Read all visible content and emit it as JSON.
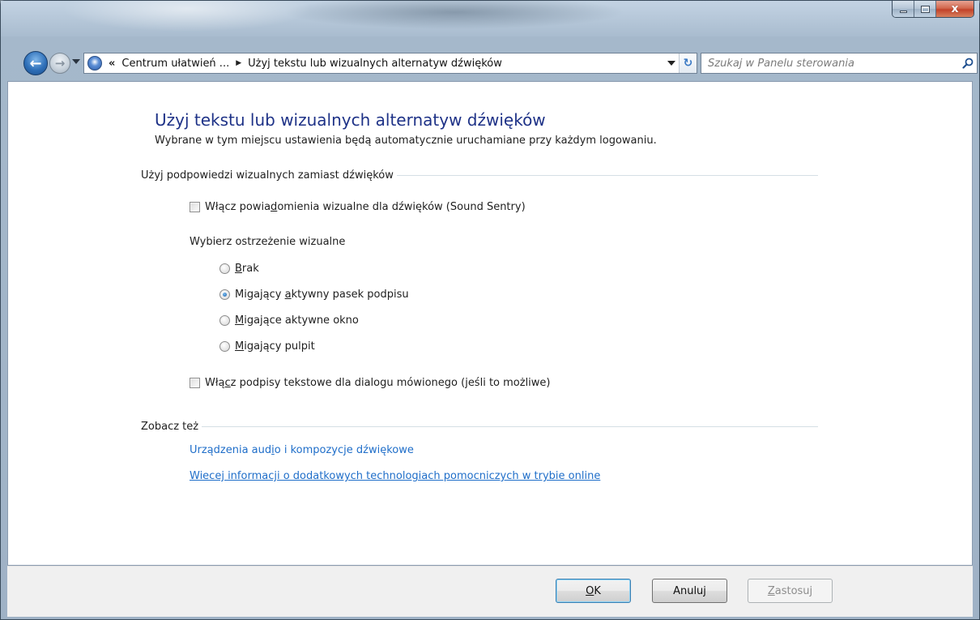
{
  "window": {
    "caption": {
      "min": "–",
      "max": "□",
      "close": "x"
    }
  },
  "nav": {
    "back_glyph": "←",
    "forward_glyph": "→",
    "address": {
      "chevrons": "«",
      "crumb1": "Centrum ułatwień ...",
      "separator": "▶",
      "crumb2": "Użyj tekstu lub wizualnych alternatyw dźwięków"
    },
    "refresh_glyph": "↻",
    "search_placeholder": "Szukaj w Panelu sterowania"
  },
  "page": {
    "title": "Użyj tekstu lub wizualnych alternatyw dźwięków",
    "subtitle": "Wybrane w tym miejscu ustawienia będą automatycznie uruchamiane przy każdym logowaniu."
  },
  "section_visual": {
    "heading": "Użyj podpowiedzi wizualnych zamiast dźwięków",
    "sound_sentry": {
      "label_pre": "Włącz powia",
      "label_ul": "d",
      "label_post": "omienia wizualne dla dźwięków (Sound Sentry)",
      "checked": false
    },
    "warning_label": "Wybierz ostrzeżenie wizualne",
    "options": [
      {
        "pre": "",
        "ul": "B",
        "post": "rak",
        "checked": false
      },
      {
        "pre": "Migający ",
        "ul": "a",
        "post": "ktywny pasek podpisu",
        "checked": true
      },
      {
        "pre": "",
        "ul": "M",
        "post": "igające aktywne okno",
        "checked": false
      },
      {
        "pre": "",
        "ul": "M",
        "post": "igający pulpit",
        "checked": false
      }
    ],
    "captions": {
      "label_pre": "Włą",
      "label_ul": "c",
      "label_post": "z podpisy tekstowe dla dialogu mówionego (jeśli to możliwe)",
      "checked": false
    }
  },
  "section_see_also": {
    "heading": "Zobacz też",
    "link1_pre": "Urządzenia aud",
    "link1_ul": "i",
    "link1_post": "o i kompozycje dźwiękowe",
    "link2": "Wiecej informacji o dodatkowych technologiach pomocniczych w trybie online"
  },
  "buttons": {
    "ok_ul": "O",
    "ok_post": "K",
    "cancel": "Anuluj",
    "apply_ul": "Z",
    "apply_post": "astosuj"
  }
}
